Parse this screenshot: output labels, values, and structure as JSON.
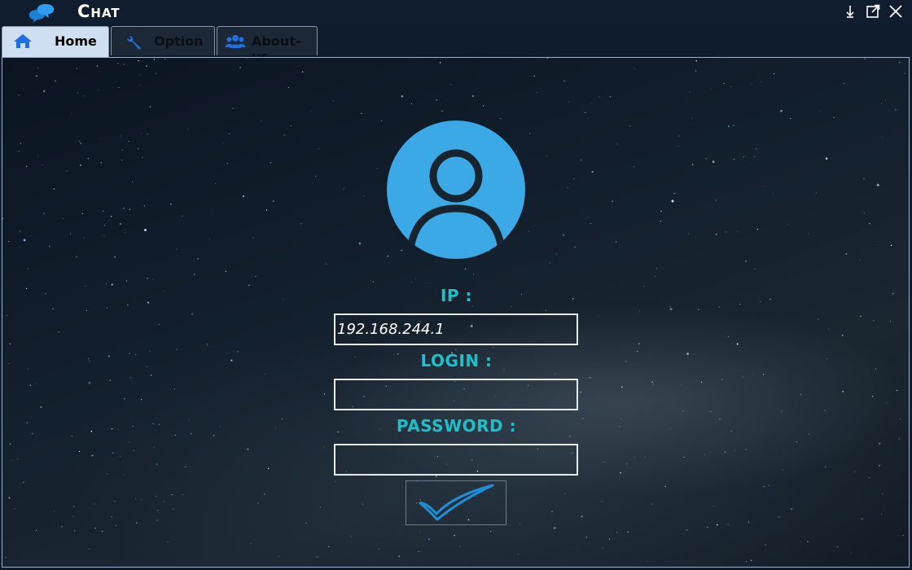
{
  "window": {
    "title": "Chat",
    "logo_icon": "chat-bubbles-icon",
    "controls": [
      "minimize-icon",
      "popout-icon",
      "close-icon"
    ]
  },
  "tabs": [
    {
      "label": "Home",
      "icon": "home-icon",
      "active": true
    },
    {
      "label": "Option",
      "icon": "wrench-icon",
      "active": false
    },
    {
      "label": "About-us",
      "icon": "users-icon",
      "active": false
    }
  ],
  "login": {
    "avatar_icon": "user-avatar-icon",
    "ip_label": "IP :",
    "ip_value": "192.168.244.1",
    "login_label": "LOGIN :",
    "login_value": "",
    "password_label": "PASSWORD :",
    "password_value": "",
    "submit_icon": "checkmark-icon"
  },
  "colors": {
    "accent": "#3aa9e6",
    "label": "#1cc0c9",
    "icon_blue": "#1f6fe0",
    "titlebar": "#0f1d2e",
    "active_tab": "#cfdff1"
  }
}
